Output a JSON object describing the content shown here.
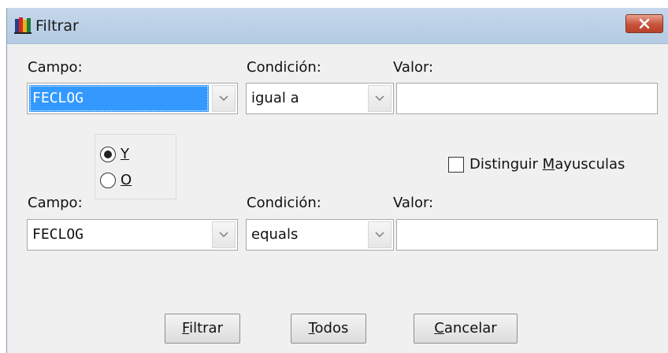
{
  "window": {
    "title": "Filtrar",
    "icon": "books-app-icon",
    "close_icon": "close-x-icon",
    "close_color": "#c8533a"
  },
  "row1": {
    "campo_label": "Campo:",
    "campo_value": "FECLOG",
    "condicion_label": "Condición:",
    "condicion_value": "igual a",
    "valor_label": "Valor:",
    "valor_value": ""
  },
  "logic": {
    "options": [
      {
        "label": "Y",
        "selected": true
      },
      {
        "label": "O",
        "selected": false
      }
    ]
  },
  "case_sensitive": {
    "label_prefix": "Distinguir ",
    "label_accel": "M",
    "label_rest": "ayusculas",
    "checked": false
  },
  "row2": {
    "campo_label": "Campo:",
    "campo_value": "FECLOG",
    "condicion_label": "Condición:",
    "condicion_value": "equals",
    "valor_label": "Valor:",
    "valor_value": ""
  },
  "buttons": {
    "filtrar": {
      "accel": "F",
      "rest": "iltrar"
    },
    "todos": {
      "accel": "T",
      "rest": "odos"
    },
    "cancelar": {
      "accel": "C",
      "rest": "ancelar"
    }
  },
  "colors": {
    "selection": "#3399ff",
    "dialog_bg": "#f0f0f0",
    "titlebar": "#b4cbe3"
  }
}
